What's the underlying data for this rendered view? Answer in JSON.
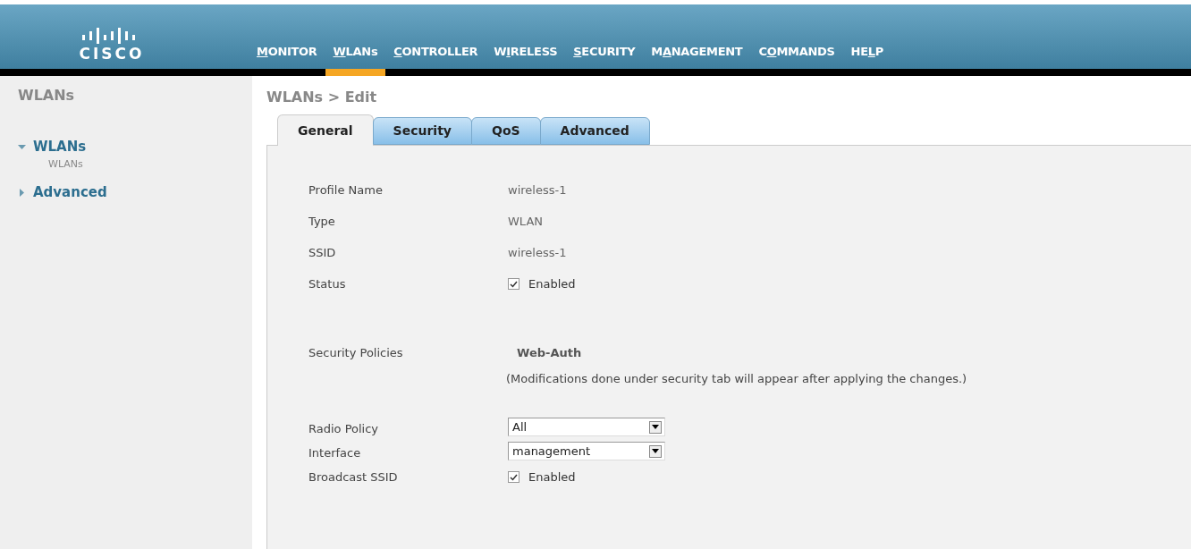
{
  "logo": {
    "text": "CISCO"
  },
  "nav": [
    {
      "key": "M",
      "post": "ONITOR",
      "selected": false
    },
    {
      "key": "W",
      "post": "LANs",
      "selected": true
    },
    {
      "key": "C",
      "post": "ONTROLLER",
      "selected": false
    },
    {
      "pre": "W",
      "key": "I",
      "post": "RELESS",
      "selected": false
    },
    {
      "key": "S",
      "post": "ECURITY",
      "selected": false
    },
    {
      "pre": "M",
      "key": "A",
      "post": "NAGEMENT",
      "selected": false
    },
    {
      "pre": "C",
      "key": "O",
      "post": "MMANDS",
      "selected": false
    },
    {
      "pre": "HE",
      "key": "L",
      "post": "P",
      "selected": false
    }
  ],
  "sidebar": {
    "title": "WLANs",
    "items": [
      {
        "label": "WLANs",
        "expanded": true,
        "children": [
          {
            "label": "WLANs"
          }
        ]
      },
      {
        "label": "Advanced",
        "expanded": false
      }
    ]
  },
  "page_title": "WLANs > Edit",
  "tabs": [
    {
      "label": "General",
      "selected": true
    },
    {
      "label": "Security",
      "selected": false
    },
    {
      "label": "QoS",
      "selected": false
    },
    {
      "label": "Advanced",
      "selected": false
    }
  ],
  "fields": [
    {
      "kind": "text",
      "label": "Profile Name",
      "value": "wireless-1"
    },
    {
      "kind": "text",
      "label": "Type",
      "value": "WLAN"
    },
    {
      "kind": "text",
      "label": "SSID",
      "value": "wireless-1"
    },
    {
      "kind": "checkbox",
      "label": "Status",
      "checked": true,
      "value": "Enabled"
    },
    {
      "kind": "policy",
      "label": "Security Policies",
      "value": "Web-Auth",
      "note": "(Modifications done under security tab will appear after applying the changes.)"
    },
    {
      "kind": "select",
      "label": "Radio Policy",
      "value": "All"
    },
    {
      "kind": "select",
      "label": "Interface",
      "value": "management"
    },
    {
      "kind": "checkbox",
      "label": "Broadcast SSID",
      "checked": true,
      "value": "Enabled"
    }
  ]
}
